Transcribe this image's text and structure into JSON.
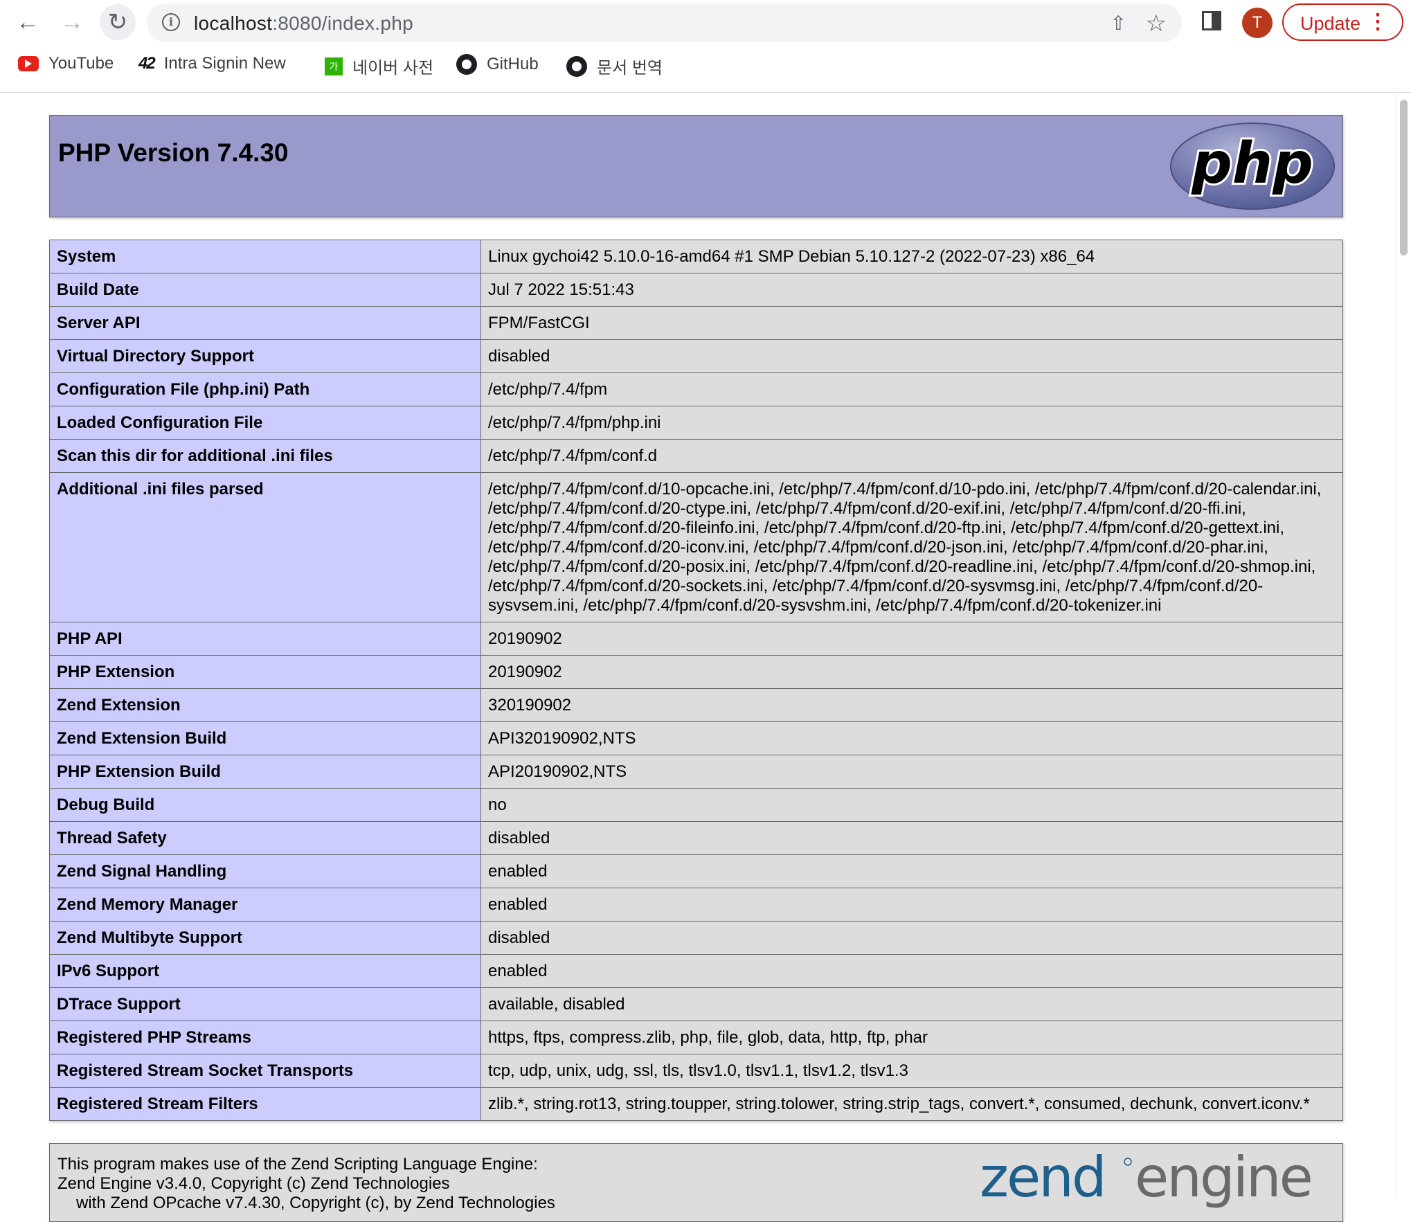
{
  "browser": {
    "url_host": "localhost",
    "url_path": ":8080/index.php",
    "avatar_letter": "T",
    "update_label": "Update",
    "bookmarks": [
      {
        "label": "YouTube",
        "icon": "youtube-icon"
      },
      {
        "label": "Intra Signin New",
        "icon": "42-icon"
      },
      {
        "label": "네이버 사전",
        "icon": "naver-dict-icon"
      },
      {
        "label": "GitHub",
        "icon": "github-icon"
      },
      {
        "label": "문서 번역",
        "icon": "github-icon"
      }
    ],
    "naver_icon_text": "가",
    "ft_icon_text": "42"
  },
  "header": {
    "title": "PHP Version 7.4.30",
    "logo_text": "php"
  },
  "rows": [
    {
      "key": "System",
      "value": "Linux gychoi42 5.10.0-16-amd64 #1 SMP Debian 5.10.127-2 (2022-07-23) x86_64"
    },
    {
      "key": "Build Date",
      "value": "Jul 7 2022 15:51:43"
    },
    {
      "key": "Server API",
      "value": "FPM/FastCGI"
    },
    {
      "key": "Virtual Directory Support",
      "value": "disabled"
    },
    {
      "key": "Configuration File (php.ini) Path",
      "value": "/etc/php/7.4/fpm"
    },
    {
      "key": "Loaded Configuration File",
      "value": "/etc/php/7.4/fpm/php.ini"
    },
    {
      "key": "Scan this dir for additional .ini files",
      "value": "/etc/php/7.4/fpm/conf.d"
    },
    {
      "key": "Additional .ini files parsed",
      "value": "/etc/php/7.4/fpm/conf.d/10-opcache.ini, /etc/php/7.4/fpm/conf.d/10-pdo.ini, /etc/php/7.4/fpm/conf.d/20-calendar.ini, /etc/php/7.4/fpm/conf.d/20-ctype.ini, /etc/php/7.4/fpm/conf.d/20-exif.ini, /etc/php/7.4/fpm/conf.d/20-ffi.ini, /etc/php/7.4/fpm/conf.d/20-fileinfo.ini, /etc/php/7.4/fpm/conf.d/20-ftp.ini, /etc/php/7.4/fpm/conf.d/20-gettext.ini, /etc/php/7.4/fpm/conf.d/20-iconv.ini, /etc/php/7.4/fpm/conf.d/20-json.ini, /etc/php/7.4/fpm/conf.d/20-phar.ini, /etc/php/7.4/fpm/conf.d/20-posix.ini, /etc/php/7.4/fpm/conf.d/20-readline.ini, /etc/php/7.4/fpm/conf.d/20-shmop.ini, /etc/php/7.4/fpm/conf.d/20-sockets.ini, /etc/php/7.4/fpm/conf.d/20-sysvmsg.ini, /etc/php/7.4/fpm/conf.d/20-sysvsem.ini, /etc/php/7.4/fpm/conf.d/20-sysvshm.ini, /etc/php/7.4/fpm/conf.d/20-tokenizer.ini"
    },
    {
      "key": "PHP API",
      "value": "20190902"
    },
    {
      "key": "PHP Extension",
      "value": "20190902"
    },
    {
      "key": "Zend Extension",
      "value": "320190902"
    },
    {
      "key": "Zend Extension Build",
      "value": "API320190902,NTS"
    },
    {
      "key": "PHP Extension Build",
      "value": "API20190902,NTS"
    },
    {
      "key": "Debug Build",
      "value": "no"
    },
    {
      "key": "Thread Safety",
      "value": "disabled"
    },
    {
      "key": "Zend Signal Handling",
      "value": "enabled"
    },
    {
      "key": "Zend Memory Manager",
      "value": "enabled"
    },
    {
      "key": "Zend Multibyte Support",
      "value": "disabled"
    },
    {
      "key": "IPv6 Support",
      "value": "enabled"
    },
    {
      "key": "DTrace Support",
      "value": "available, disabled"
    },
    {
      "key": "Registered PHP Streams",
      "value": "https, ftps, compress.zlib, php, file, glob, data, http, ftp, phar"
    },
    {
      "key": "Registered Stream Socket Transports",
      "value": "tcp, udp, unix, udg, ssl, tls, tlsv1.0, tlsv1.1, tlsv1.2, tlsv1.3"
    },
    {
      "key": "Registered Stream Filters",
      "value": "zlib.*, string.rot13, string.toupper, string.tolower, string.strip_tags, convert.*, consumed, dechunk, convert.iconv.*"
    }
  ],
  "footer": {
    "line1": "This program makes use of the Zend Scripting Language Engine:",
    "line2": "Zend Engine v3.4.0, Copyright (c) Zend Technologies",
    "line3": "with Zend OPcache v7.4.30, Copyright (c), by Zend Technologies",
    "logo_zend": "zend",
    "logo_engine": "engine"
  },
  "colors": {
    "header_bg": "#9999cc",
    "key_bg": "#ccccff",
    "value_bg": "#dddddd",
    "update_red": "#c5221f",
    "avatar": "#b83a1a"
  }
}
